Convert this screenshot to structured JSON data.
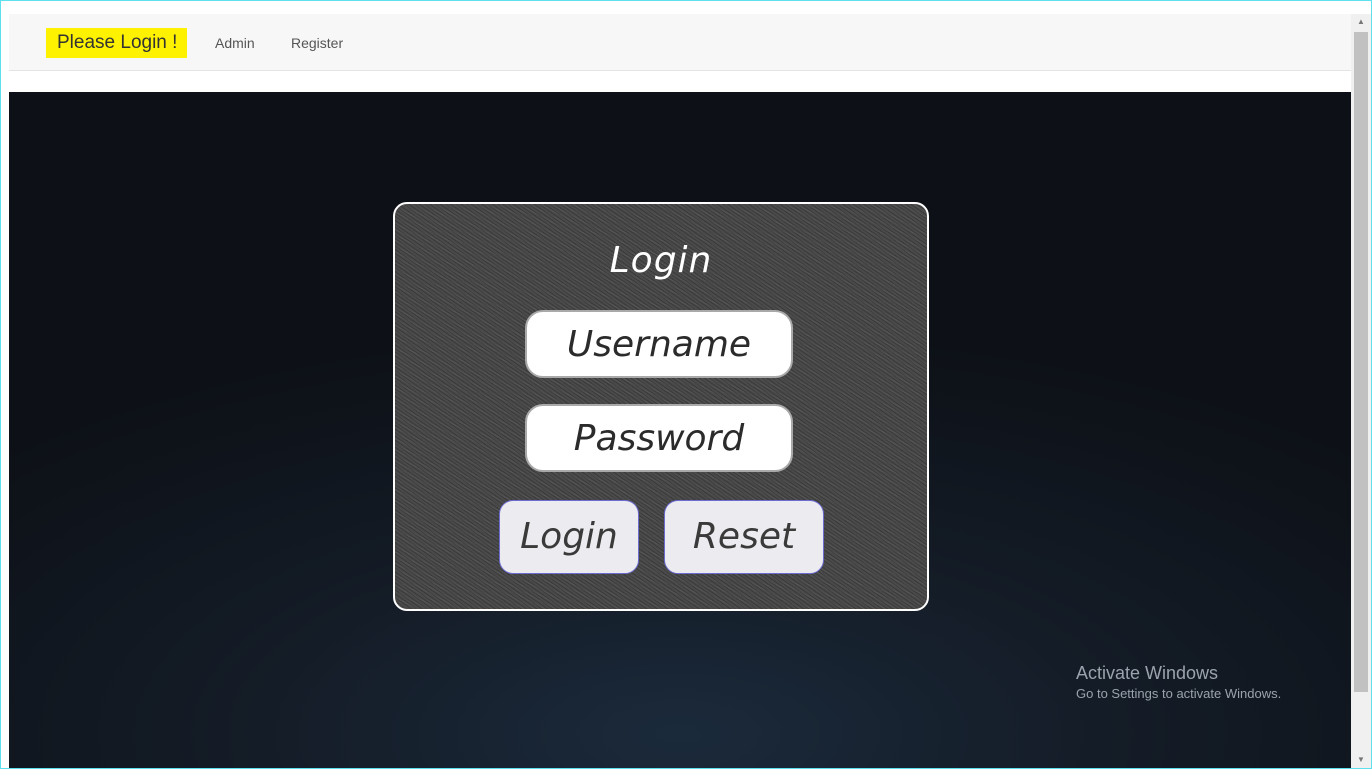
{
  "navbar": {
    "brand": "Please Login !",
    "links": [
      "Admin",
      "Register"
    ],
    "brand_highlight_color": "#fff200"
  },
  "login_card": {
    "title": "Login",
    "username_placeholder": "Username",
    "password_placeholder": "Password",
    "login_button": "Login",
    "reset_button": "Reset"
  },
  "watermark": {
    "title": "Activate Windows",
    "subtitle": "Go to Settings to activate Windows."
  },
  "scrollbar": {
    "up_icon": "chevron-up-icon",
    "down_icon": "chevron-down-icon"
  }
}
